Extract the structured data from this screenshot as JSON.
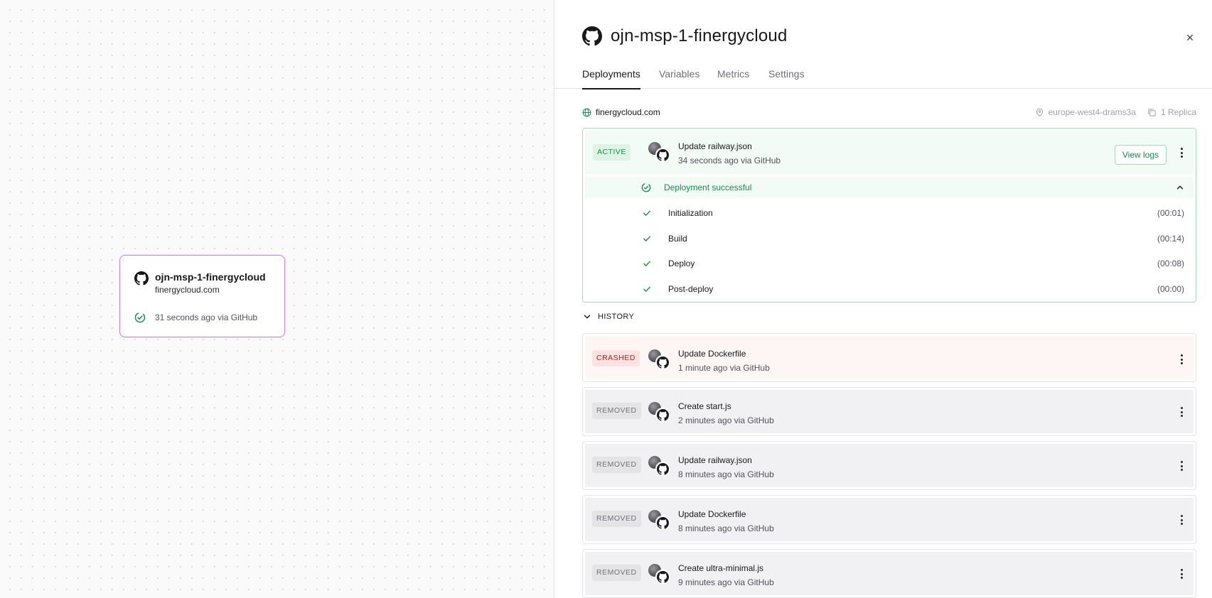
{
  "canvas": {
    "service": {
      "name": "ojn-msp-1-finergycloud",
      "domain": "finergycloud.com",
      "status": "31 seconds ago via GitHub"
    }
  },
  "panel": {
    "title": "ojn-msp-1-finergycloud",
    "close_label": "×",
    "tabs": [
      {
        "label": "Deployments",
        "active": true
      },
      {
        "label": "Variables",
        "active": false
      },
      {
        "label": "Metrics",
        "active": false
      },
      {
        "label": "Settings",
        "active": false
      }
    ],
    "domain": "finergycloud.com",
    "region": "europe-west4-drams3a",
    "replicas": "1 Replica",
    "active_deployment": {
      "badge": "ACTIVE",
      "commit": "Update railway.json",
      "when": "34 seconds ago via GitHub",
      "view_logs_label": "View logs",
      "status": "Deployment successful",
      "steps": [
        {
          "label": "Initialization",
          "duration": "(00:01)"
        },
        {
          "label": "Build",
          "duration": "(00:14)"
        },
        {
          "label": "Deploy",
          "duration": "(00:08)"
        },
        {
          "label": "Post-deploy",
          "duration": "(00:00)"
        }
      ]
    },
    "history_label": "HISTORY",
    "history": [
      {
        "badge": "CRASHED",
        "commit": "Update Dockerfile",
        "when": "1 minute ago via GitHub"
      },
      {
        "badge": "REMOVED",
        "commit": "Create start.js",
        "when": "2 minutes ago via GitHub"
      },
      {
        "badge": "REMOVED",
        "commit": "Update railway.json",
        "when": "8 minutes ago via GitHub"
      },
      {
        "badge": "REMOVED",
        "commit": "Update Dockerfile",
        "when": "8 minutes ago via GitHub"
      },
      {
        "badge": "REMOVED",
        "commit": "Create ultra-minimal.js",
        "when": "9 minutes ago via GitHub"
      }
    ]
  },
  "colors": {
    "success": "#1c8a4e",
    "success_bg": "#f3fbf6",
    "crashed": "#b42318",
    "card_border": "#c084fc"
  },
  "icons": [
    "github-icon",
    "check-circle-icon",
    "close-icon",
    "globe-icon",
    "location-pin-icon",
    "copy-icon",
    "check-icon",
    "chevron-up-icon",
    "chevron-down-icon",
    "kebab-menu-icon"
  ]
}
